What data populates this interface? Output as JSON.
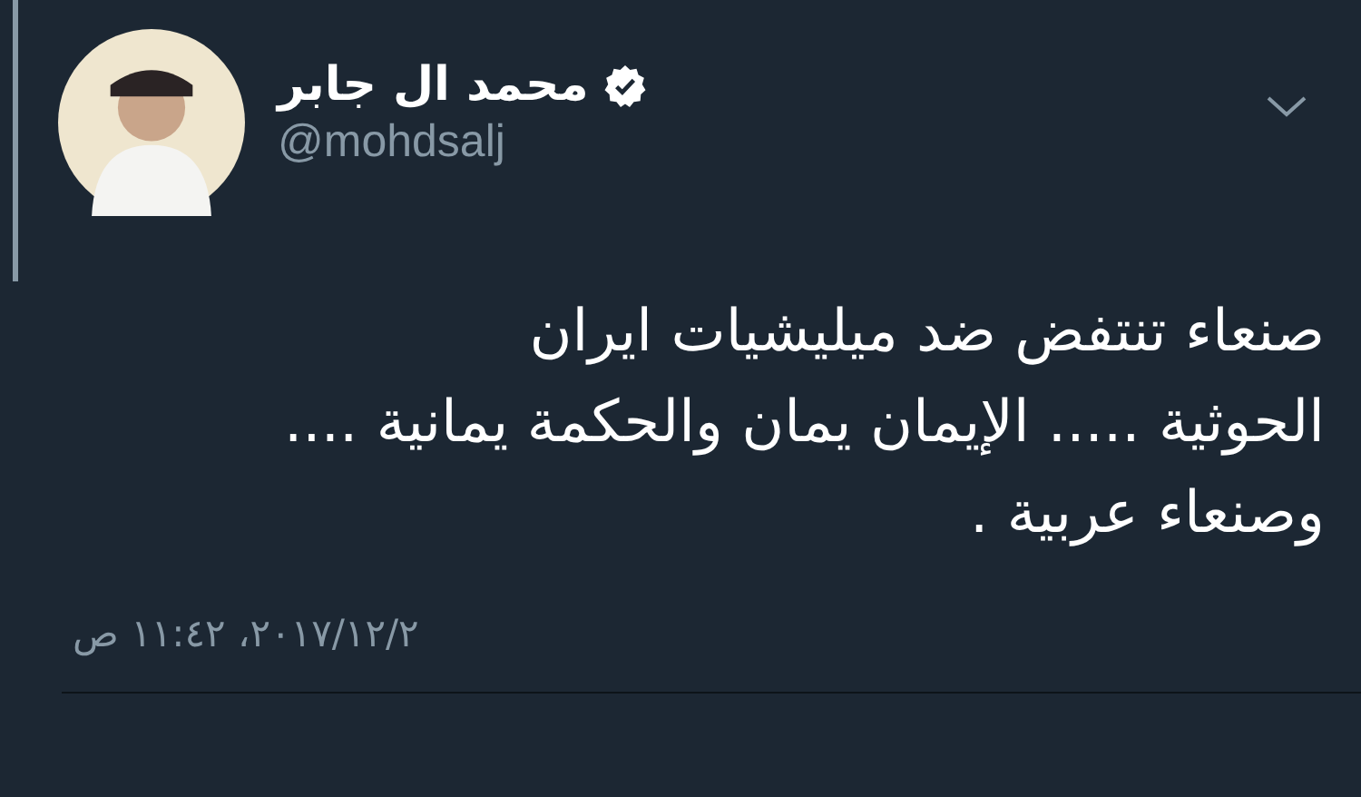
{
  "author": {
    "name": "محمد ال جابر",
    "verified": true,
    "handle": "@mohdsalj"
  },
  "tweet": {
    "lines": [
      "صنعاء تنتفض ضد ميليشيات ايران",
      "الحوثية ..... الإيمان يمان والحكمة يمانية ....",
      "وصنعاء عربية ."
    ],
    "timestamp": "٢٠١٧/١٢/٢، ١١:٤٢ ص"
  }
}
